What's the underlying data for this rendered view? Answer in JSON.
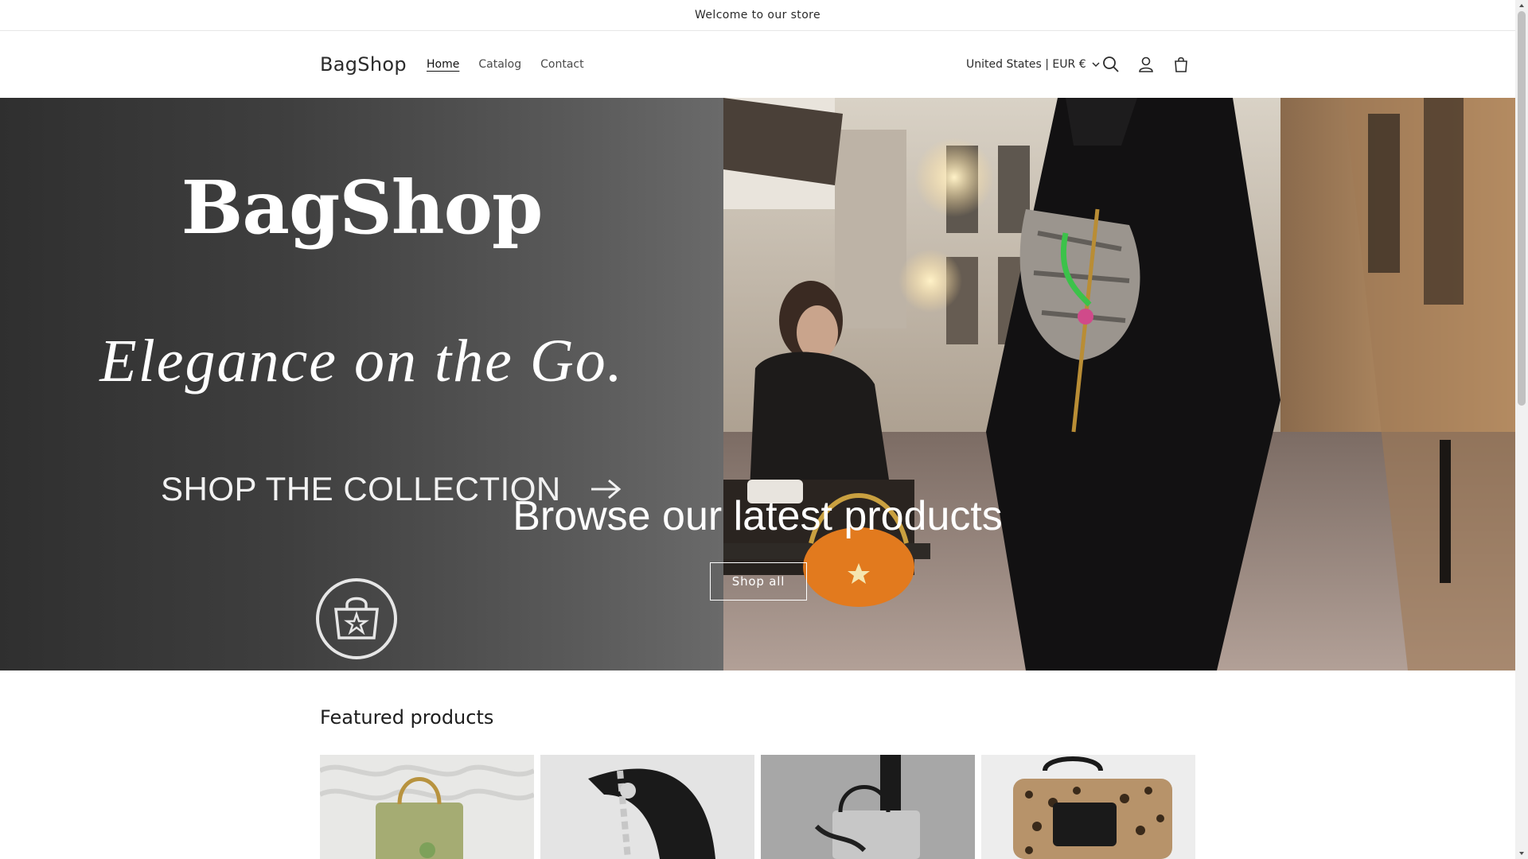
{
  "announcement": "Welcome to our store",
  "header": {
    "logo": "BagShop",
    "nav": [
      "Home",
      "Catalog",
      "Contact"
    ],
    "country": "United States | EUR €",
    "icons": [
      "search-icon",
      "account-icon",
      "cart-icon"
    ]
  },
  "hero": {
    "brand": "BagShop",
    "tagline": "Elegance on the Go.",
    "collection": "SHOP THE COLLECTION",
    "heading": "Browse our latest products",
    "button": "Shop all"
  },
  "featured": {
    "title": "Featured products"
  },
  "colors": {
    "text": "#121212",
    "hero_left": "#3f3f3f",
    "border": "#e6e6e6"
  }
}
